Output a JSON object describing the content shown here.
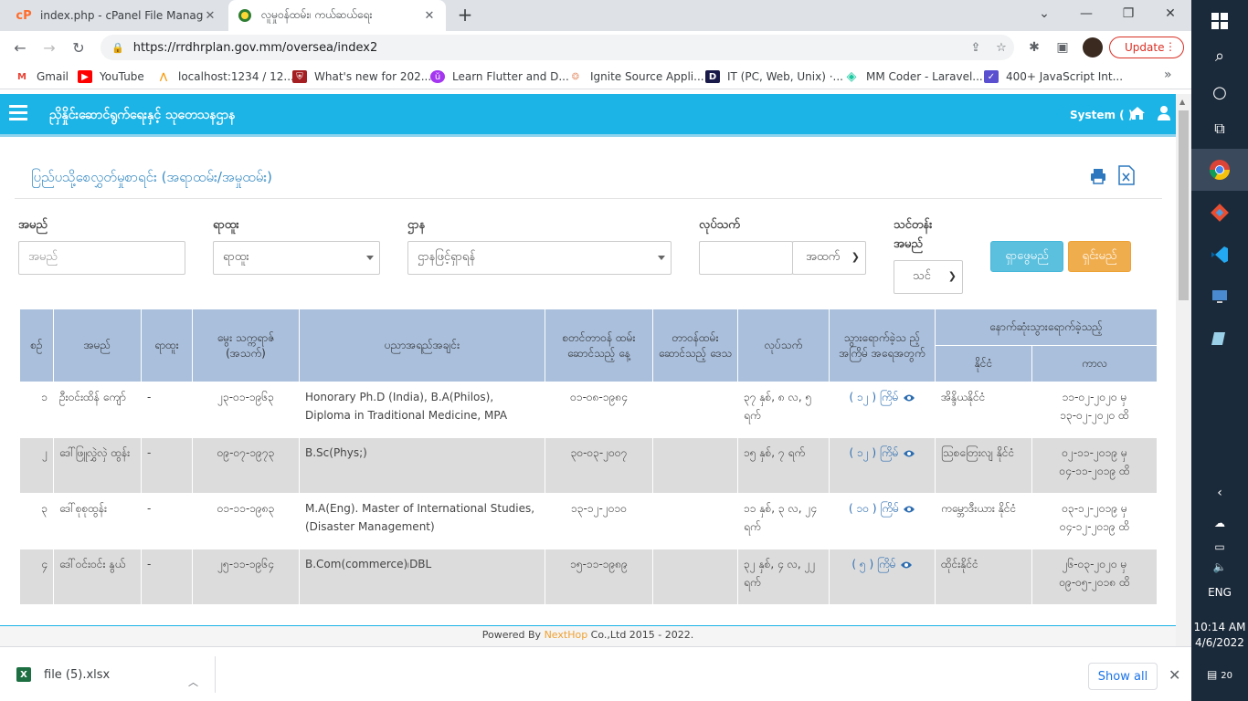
{
  "browser": {
    "tabs": [
      {
        "title": "index.php - cPanel File Manager v",
        "active": false
      },
      {
        "title": "လူမှုဝန်ထမ်း၊ ကယ်ဆယ်ရေး",
        "active": true
      }
    ],
    "url": "https://rrdhrplan.gov.mm/oversea/index2",
    "update_label": "Update",
    "bookmarks": [
      {
        "label": "Gmail",
        "icon": "gmail-icon",
        "color": "#ea4335"
      },
      {
        "label": "YouTube",
        "icon": "youtube-icon",
        "color": "#ff0000"
      },
      {
        "label": "localhost:1234 / 12...",
        "icon": "phpmyadmin-icon",
        "color": "#f89c0e"
      },
      {
        "label": "What's new for 202...",
        "icon": "shield-icon",
        "color": "#a41e22"
      },
      {
        "label": "Learn Flutter and D...",
        "icon": "udemy-icon",
        "color": "#a435f0"
      },
      {
        "label": "Ignite Source Appli...",
        "icon": "ignite-icon",
        "color": "#e8a080"
      },
      {
        "label": "IT (PC, Web, Unix) ·...",
        "icon": "d-icon",
        "color": "#1a1a4a"
      },
      {
        "label": "MM Coder - Laravel...",
        "icon": "mmcoder-icon",
        "color": "#1ac9a0"
      },
      {
        "label": "400+ JavaScript Int...",
        "icon": "js-icon",
        "color": "#5a4fcf"
      }
    ]
  },
  "app": {
    "title": "ညှိနှိုင်းဆောင်ရွက်ရေးနှင့် သုတေသနဌာန",
    "system_label": "System ( )",
    "page_heading": "ပြည်ပသို့စေလွှတ်မှုစာရင်း (အရာထမ်း/အမှုထမ်း)",
    "filters": {
      "name_label": "အမည်",
      "name_placeholder": "အမည်",
      "rank_label": "ရာထူး",
      "rank_value": "ရာထူး",
      "dept_label": "ဌာန",
      "dept_value": "ဌာနဖြင့်ရှာရန်",
      "service_label": "လုပ်သက်",
      "service_unit": "အထက်",
      "course_label_1": "သင်တန်း",
      "course_label_2": "အမည်",
      "course_value": "သင်",
      "search_button": "ရှာဖွေမည်",
      "clear_button": "ရှင်းမည်"
    },
    "table": {
      "headers": {
        "no": "စဉ်",
        "name": "အမည်",
        "rank": "ရာထူး",
        "dob": "မွေး သက္ကရာဇ် (အသက်)",
        "education": "ပညာအရည်အချင်း",
        "start_date": "စတင်တာဝန် ထမ်းဆောင်သည့် နေ့",
        "region": "တာဝန်ထမ်း ဆောင်သည့် ဒေသ",
        "service": "လုပ်သက်",
        "trips": "သွားရောက်ခဲ့သ ည့် အကြိမ် အရေအတွက်",
        "last_trip": "နောက်ဆုံးသွားရောက်ခဲ့သည့်",
        "country": "နိုင်ငံ",
        "period": "ကာလ"
      },
      "rows": [
        {
          "no": "၁",
          "name": "ဦးဝင်းထိန် ကျော်",
          "rank": "-",
          "dob": "၂၃-၀၁-၁၉၆၃",
          "education": "Honorary Ph.D (India), B.A(Philos), Diploma in Traditional Medicine, MPA",
          "start_date": "၀၁-၀၈-၁၉၈၄",
          "region": "",
          "service": "၃၇ နှစ်, ၈ လ, ၅ ရက်",
          "trips": "( ၁၂ ) ကြိမ်",
          "country": "အိန္ဒိယနိုင်ငံ",
          "period": "၁၁-၀၂-၂၀၂၀ မှ ၁၃-၀၂-၂၀၂၀ ထိ"
        },
        {
          "no": "၂",
          "name": "ဒေါ်ဖြူလွှဲလှဲ ထွန်း",
          "rank": "-",
          "dob": "၀၉-၀၇-၁၉၇၃",
          "education": "B.Sc(Phys;)",
          "start_date": "၃၀-၀၃-၂၀၀၇",
          "region": "",
          "service": "၁၅ နှစ်, ၇ ရက်",
          "trips": "( ၁၂ ) ကြိမ်",
          "country": "ဩစတြေးလျ နိုင်ငံ",
          "period": "၀၂-၁၁-၂၀၁၉ မှ ၀၄-၁၁-၂၀၁၉ ထိ"
        },
        {
          "no": "၃",
          "name": "ဒေါ်စုစုထွန်း",
          "rank": "-",
          "dob": "၀၁-၁၁-၁၉၈၃",
          "education": "M.A(Eng). Master of International Studies,(Disaster Management)",
          "start_date": "၁၃-၁၂-၂၀၁၀",
          "region": "",
          "service": "၁၁ နှစ်, ၃ လ, ၂၄ ရက်",
          "trips": "( ၁၀ ) ကြိမ်",
          "country": "ကမ္ဘောဒီးယား နိုင်ငံ",
          "period": "၀၃-၁၂-၂၀၁၉ မှ ၀၄-၁၂-၂၀၁၉ ထိ"
        },
        {
          "no": "၄",
          "name": "ဒေါ်ဝင်းဝင်း နွယ်",
          "rank": "-",
          "dob": "၂၅-၁၁-၁၉၆၄",
          "education": "B.Com(commerce)၊DBL",
          "start_date": "၁၅-၁၁-၁၉၈၉",
          "region": "",
          "service": "၃၂ နှစ်, ၄ လ, ၂၂ ရက်",
          "trips": "( ၅ ) ကြိမ်",
          "country": "ထိုင်းနိုင်ငံ",
          "period": "၂၆-၀၃-၂၀၂၀ မှ ၀၉-၀၅-၂၀၁၈ ထိ"
        }
      ]
    },
    "footer": {
      "prefix": "Powered By ",
      "brand": "NextHop",
      "suffix": " Co.,Ltd 2015 - 2022."
    }
  },
  "downloads": {
    "file": "file (5).xlsx",
    "show_all": "Show all"
  },
  "taskbar": {
    "time": "10:14 AM",
    "date": "4/6/2022",
    "lang": "ENG",
    "notifications": "20"
  }
}
